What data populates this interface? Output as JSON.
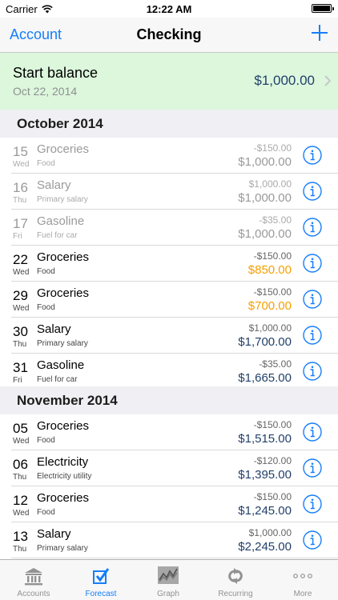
{
  "status": {
    "carrier": "Carrier",
    "time": "12:22 AM"
  },
  "nav": {
    "back": "Account",
    "title": "Checking"
  },
  "start": {
    "label": "Start balance",
    "date": "Oct 22, 2014",
    "amount": "$1,000.00"
  },
  "sections": [
    {
      "title": "October 2014"
    },
    {
      "title": "November 2014"
    }
  ],
  "rows": [
    {
      "day": "15",
      "dow": "Wed",
      "name": "Groceries",
      "sub": "Food",
      "amount": "-$150.00",
      "balance": "$1,000.00"
    },
    {
      "day": "16",
      "dow": "Thu",
      "name": "Salary",
      "sub": "Primary salary",
      "amount": "$1,000.00",
      "balance": "$1,000.00"
    },
    {
      "day": "17",
      "dow": "Fri",
      "name": "Gasoline",
      "sub": "Fuel for car",
      "amount": "-$35.00",
      "balance": "$1,000.00"
    },
    {
      "day": "22",
      "dow": "Wed",
      "name": "Groceries",
      "sub": "Food",
      "amount": "-$150.00",
      "balance": "$850.00"
    },
    {
      "day": "29",
      "dow": "Wed",
      "name": "Groceries",
      "sub": "Food",
      "amount": "-$150.00",
      "balance": "$700.00"
    },
    {
      "day": "30",
      "dow": "Thu",
      "name": "Salary",
      "sub": "Primary salary",
      "amount": "$1,000.00",
      "balance": "$1,700.00"
    },
    {
      "day": "31",
      "dow": "Fri",
      "name": "Gasoline",
      "sub": "Fuel for car",
      "amount": "-$35.00",
      "balance": "$1,665.00"
    },
    {
      "day": "05",
      "dow": "Wed",
      "name": "Groceries",
      "sub": "Food",
      "amount": "-$150.00",
      "balance": "$1,515.00"
    },
    {
      "day": "06",
      "dow": "Thu",
      "name": "Electricity",
      "sub": "Electricity utility",
      "amount": "-$120.00",
      "balance": "$1,395.00"
    },
    {
      "day": "12",
      "dow": "Wed",
      "name": "Groceries",
      "sub": "Food",
      "amount": "-$150.00",
      "balance": "$1,245.00"
    },
    {
      "day": "13",
      "dow": "Thu",
      "name": "Salary",
      "sub": "Primary salary",
      "amount": "$1,000.00",
      "balance": "$2,245.00"
    }
  ],
  "tabs": [
    {
      "label": "Accounts",
      "icon": "bank-icon"
    },
    {
      "label": "Forecast",
      "icon": "checkbox-icon"
    },
    {
      "label": "Graph",
      "icon": "graph-icon"
    },
    {
      "label": "Recurring",
      "icon": "repeat-icon"
    },
    {
      "label": "More",
      "icon": "more-icon"
    }
  ],
  "colors": {
    "accent": "#157efb",
    "balance": "#22406b",
    "warning": "#f5a000",
    "start_bg": "#dcf7dc"
  }
}
